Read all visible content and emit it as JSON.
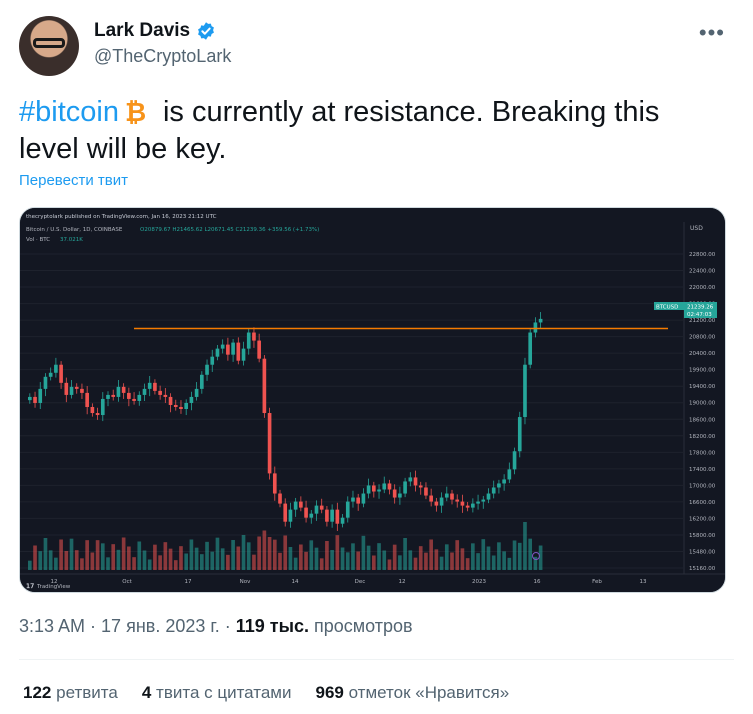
{
  "author": {
    "name": "Lark Davis",
    "handle": "@TheCryptoLark"
  },
  "tweet": {
    "hashtag": "#bitcoin",
    "text_line1_rest": "is currently at resistance. Breaking this",
    "text_line2": "level will be key.",
    "translate_label": "Перевести твит"
  },
  "chart": {
    "header": "thecryptolark published on TradingView.com, Jan 16, 2023 21:12 UTC",
    "symbol_line": "Bitcoin / U.S. Dollar, 1D, COINBASE",
    "ohlc": "O20879.67 H21465.62 L20671.45 C21239.36 +359.56 (+1.73%)",
    "volume_line": "Vol · BTC",
    "volume_value": "37.021K",
    "currency": "USD",
    "price_tag_symbol": "BTCUSD",
    "price_tag_value": "21239.26",
    "price_tag_time": "02:47:03",
    "footer_brand": "TradingView",
    "accent_up": "#26a69a",
    "accent_down": "#ef5350",
    "resistance_color": "#f57c00"
  },
  "chart_data": {
    "type": "candlestick",
    "resistance": 21000,
    "ylim": [
      15000,
      23000
    ],
    "y_ticks": [
      "22800.00",
      "22400.00",
      "22000.00",
      "21600.00",
      "21200.00",
      "20800.00",
      "20400.00",
      "19900.00",
      "19400.00",
      "19000.00",
      "18600.00",
      "18200.00",
      "17800.00",
      "17400.00",
      "17000.00",
      "16600.00",
      "16200.00",
      "15800.00",
      "15480.00",
      "15160.00"
    ],
    "x_ticks": [
      "12",
      "Oct",
      "17",
      "Nov",
      "14",
      "Dec",
      "12",
      "2023",
      "16",
      "Feb",
      "13"
    ],
    "close_series": [
      19300,
      19150,
      19500,
      19800,
      19900,
      20100,
      19650,
      19350,
      19550,
      19500,
      19400,
      19050,
      18900,
      18850,
      19250,
      19350,
      19300,
      19550,
      19400,
      19250,
      19200,
      19350,
      19500,
      19650,
      19450,
      19350,
      19300,
      19100,
      19050,
      19000,
      19150,
      19300,
      19500,
      19850,
      20100,
      20300,
      20500,
      20600,
      20350,
      20650,
      20200,
      20500,
      20900,
      20700,
      20250,
      18900,
      17400,
      16900,
      16650,
      16200,
      16500,
      16700,
      16550,
      16300,
      16400,
      16600,
      16500,
      16200,
      16500,
      16150,
      16300,
      16700,
      16800,
      16650,
      16900,
      17100,
      16950,
      17000,
      17150,
      17000,
      16800,
      16900,
      17200,
      17300,
      17100,
      17050,
      16850,
      16700,
      16600,
      16800,
      16900,
      16750,
      16700,
      16600,
      16550,
      16650,
      16700,
      16750,
      16900,
      17050,
      17150,
      17250,
      17500,
      17950,
      18800,
      20100,
      20900,
      21150,
      21239
    ]
  },
  "meta": {
    "time": "3:13 AM",
    "date": "17 янв. 2023 г.",
    "views_count": "119 тыс.",
    "views_label": "просмотров"
  },
  "stats": {
    "retweets_count": "122",
    "retweets_label": "ретвита",
    "quotes_count": "4",
    "quotes_label": "твита с цитатами",
    "likes_count": "969",
    "likes_label": "отметок «Нравится»"
  },
  "icons": {
    "verified": "verified-badge-icon",
    "more": "more-options-icon",
    "bitcoin": "bitcoin-emoji-icon"
  }
}
